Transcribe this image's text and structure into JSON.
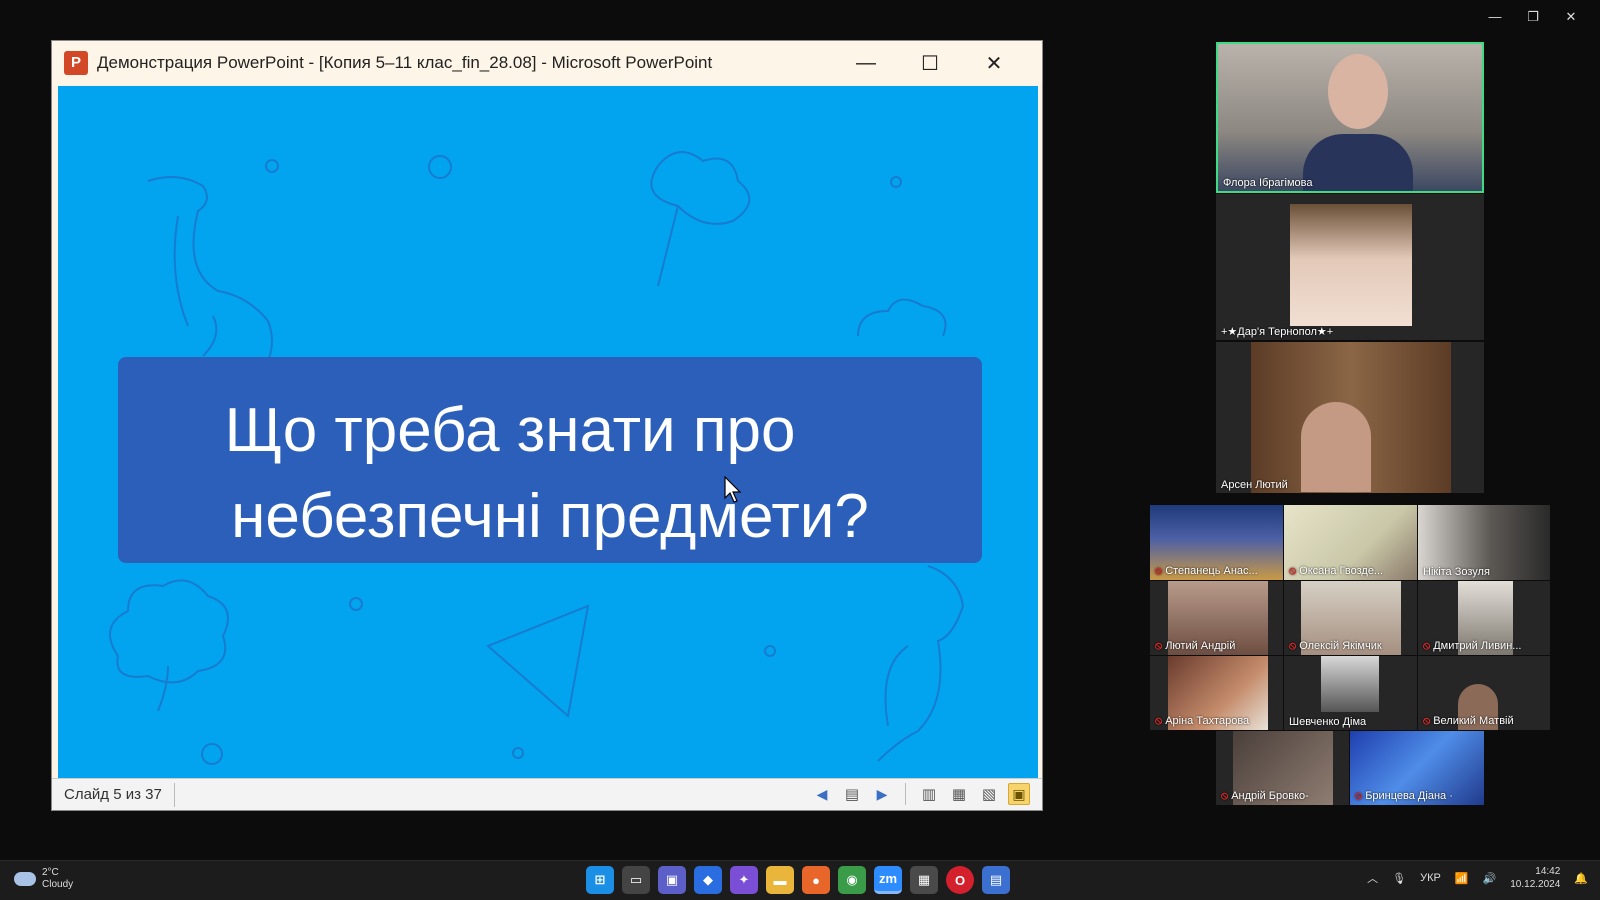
{
  "powerpoint": {
    "title": "Демонстрация PowerPoint - [Копия 5–11 клас_fin_28.08] - Microsoft PowerPoint",
    "logo_letter": "P",
    "minimize": "—",
    "maximize": "☐",
    "close": "✕",
    "slide_title_line1": "Що треба знати про",
    "slide_title_line2": "небезпечні предмети?",
    "slide_counter": "Слайд 5 из 37"
  },
  "participants": [
    {
      "name": "Флора Ібрагімова",
      "muted": false,
      "active_speaker": true
    },
    {
      "name": "+★Дар'я Тернопол★+",
      "muted": false
    },
    {
      "name": "Арсен Лютий",
      "muted": false
    },
    {
      "name": "Степанець Анас...",
      "muted": true
    },
    {
      "name": "Оксана Гвозде...",
      "muted": true
    },
    {
      "name": "Нікіта Зозуля",
      "muted": false
    },
    {
      "name": "Лютий Андрій",
      "muted": true
    },
    {
      "name": "Олексій Якімчик",
      "muted": true
    },
    {
      "name": "Дмитрий Ливин...",
      "muted": true
    },
    {
      "name": "Аріна Тахтарова",
      "muted": true
    },
    {
      "name": "Шевченко Діма",
      "muted": false
    },
    {
      "name": "Великий Матвій",
      "muted": true
    },
    {
      "name": "Андрій Бровко-",
      "muted": true
    },
    {
      "name": "Бринцева Діана ·",
      "muted": true
    }
  ],
  "taskbar": {
    "temperature": "2°C",
    "weather": "Cloudy",
    "language": "УКР",
    "time": "14:42",
    "date": "10.12.2024"
  },
  "colors": {
    "slide_bg": "#02a4ef",
    "title_box": "#2b5fba",
    "active_speaker_border": "#3ddc84"
  }
}
